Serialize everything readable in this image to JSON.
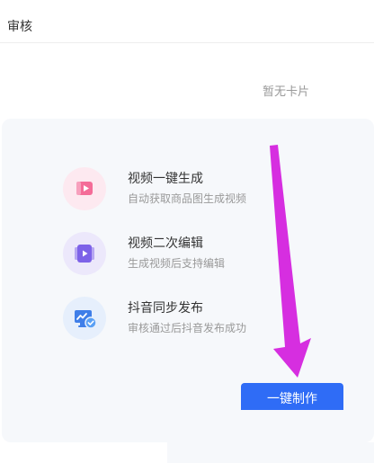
{
  "header": {
    "title": "审核"
  },
  "cards": {
    "empty_text": "暂无卡片"
  },
  "features": [
    {
      "icon": "video-play-icon",
      "title": "视频一键生成",
      "desc": "自动获取商品图生成视频"
    },
    {
      "icon": "video-edit-icon",
      "title": "视频二次编辑",
      "desc": "生成视频后支持编辑"
    },
    {
      "icon": "douyin-publish-icon",
      "title": "抖音同步发布",
      "desc": "审核通过后抖音发布成功"
    }
  ],
  "actions": {
    "make_label": "一键制作"
  },
  "colors": {
    "accent": "#2f6cf6",
    "annotation_arrow": "#d62ee0",
    "panel_bg": "#f6f8fb"
  }
}
